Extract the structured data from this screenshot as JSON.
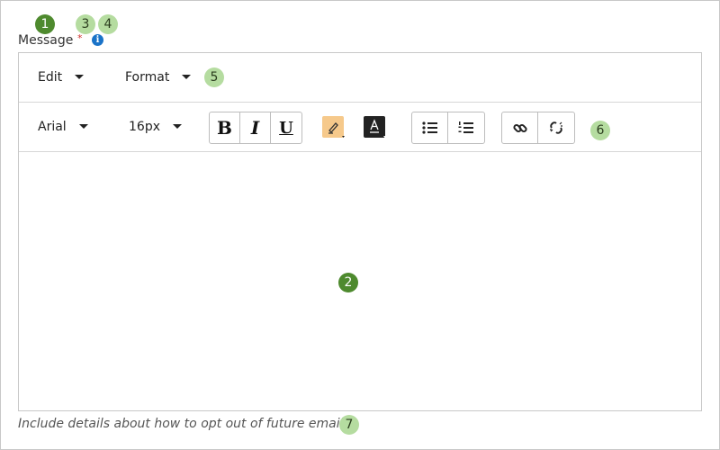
{
  "field": {
    "label": "Message",
    "required_marker": "*",
    "info_glyph": "i",
    "helper_text": "Include details about how to opt out of future email."
  },
  "menubar": {
    "edit_label": "Edit",
    "format_label": "Format"
  },
  "toolbar": {
    "font_family": "Arial",
    "font_size": "16px",
    "bold_label": "B",
    "italic_label": "I",
    "underline_label": "U",
    "highlight_icon": "highlighter-icon",
    "text_color_icon": "text-color-icon",
    "highlight_color": "#f6c98b",
    "text_color": "#222222",
    "bullet_list_icon": "bullet-list-icon",
    "numbered_list_icon": "numbered-list-icon",
    "link_icon": "link-icon",
    "unlink_icon": "unlink-icon"
  },
  "editor": {
    "content": ""
  },
  "annotations": [
    "1",
    "2",
    "3",
    "4",
    "5",
    "6",
    "7"
  ],
  "colors": {
    "badge_dark": "#4e8a2e",
    "badge_light": "#b5dca0",
    "required": "#d0312d",
    "info": "#1a73c8"
  }
}
